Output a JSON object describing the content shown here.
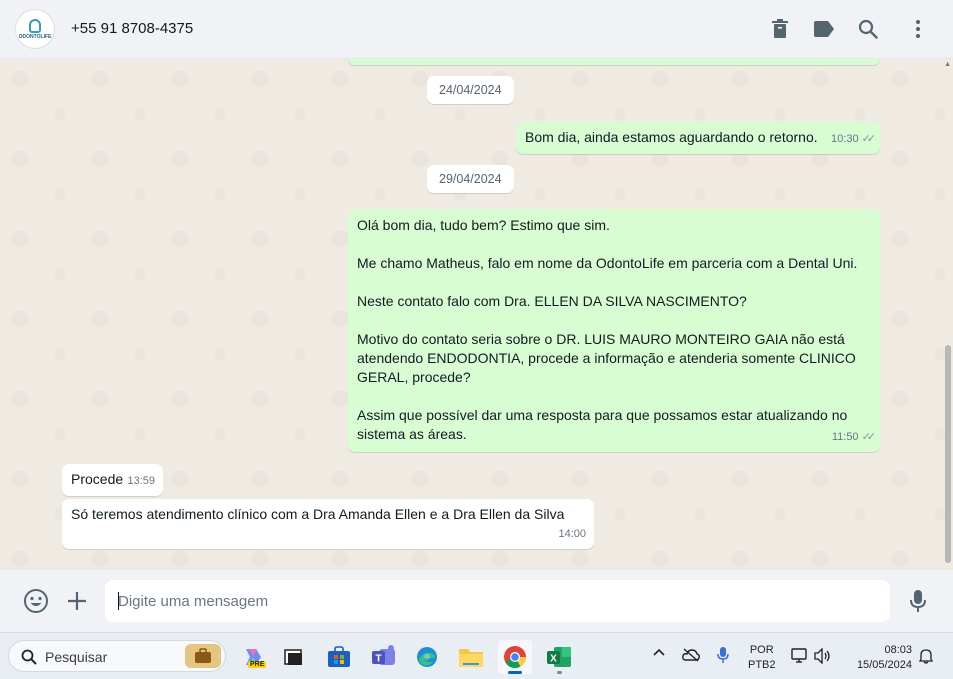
{
  "header": {
    "contact_name": "+55 91 8708-4375",
    "avatar_brand": "ODONTOLIFE",
    "icons": [
      "archive-icon",
      "label-icon",
      "search-icon",
      "menu-icon"
    ]
  },
  "chat": {
    "date_chips": [
      "24/04/2024",
      "29/04/2024"
    ],
    "messages": [
      {
        "direction": "out",
        "text": "Bom dia, ainda estamos aguardando o retorno.",
        "time": "10:30",
        "status": "read"
      },
      {
        "direction": "out",
        "paragraphs": [
          "Olá bom dia, tudo bem? Estimo que sim.",
          "Me chamo Matheus, falo em nome da OdontoLife em parceria com a Dental Uni.",
          "Neste contato falo com Dra. ELLEN DA SILVA NASCIMENTO?",
          "Motivo do contato seria sobre o DR. LUIS MAURO MONTEIRO GAIA não está atendendo ENDODONTIA, procede a informação e atenderia somente CLINICO GERAL, procede?",
          "Assim que possível dar uma resposta para que possamos estar atualizando no sistema as áreas."
        ],
        "time": "11:50",
        "status": "read"
      },
      {
        "direction": "in",
        "text": "Procede",
        "time": "13:59"
      },
      {
        "direction": "in",
        "text": "Só teremos atendimento clínico com a Dra Amanda Ellen e a Dra Ellen da Silva",
        "time": "14:00"
      }
    ]
  },
  "composer": {
    "placeholder": "Digite uma mensagem"
  },
  "taskbar": {
    "search_label": "Pesquisar",
    "copilot_badge": "PRE",
    "language_line1": "POR",
    "language_line2": "PTB2",
    "time": "08:03",
    "date": "15/05/2024"
  },
  "colors": {
    "outgoing_bubble": "#d9fdd3",
    "incoming_bubble": "#ffffff",
    "chat_background": "#efeae2",
    "header_background": "#f0f2f5"
  }
}
